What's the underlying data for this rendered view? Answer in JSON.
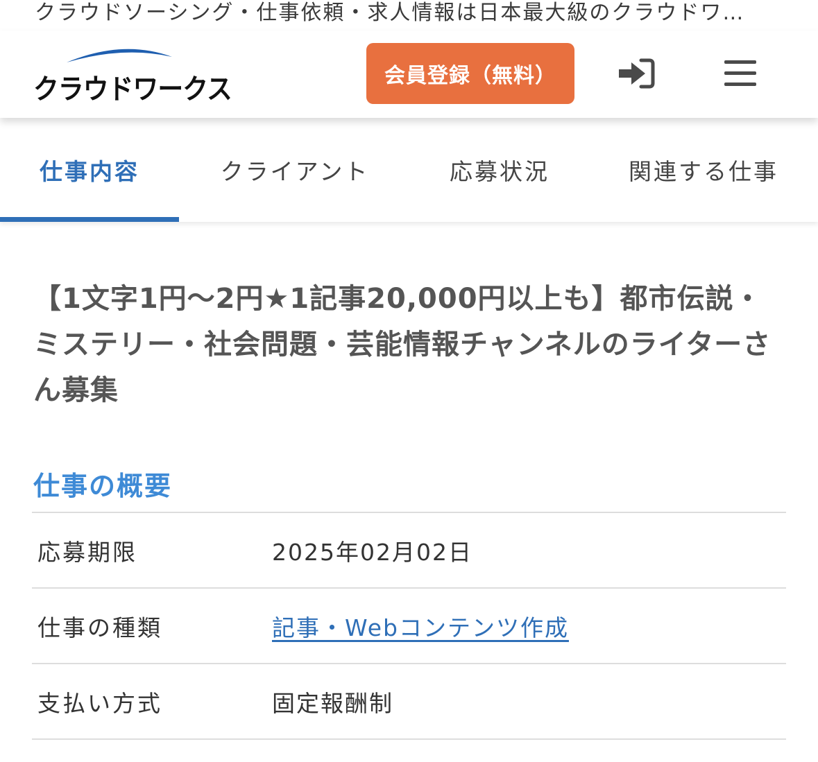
{
  "page_title": "クラウドソーシング・仕事依頼・求人情報は日本最大級のクラウドワ…",
  "header": {
    "logo_text": "クラウドワークス",
    "register_button_label": "会員登録（無料）",
    "login_icon": "login-arrow-icon",
    "menu_icon": "hamburger-menu-icon"
  },
  "tabs": [
    {
      "label": "仕事内容",
      "active": true
    },
    {
      "label": "クライアント",
      "active": false
    },
    {
      "label": "応募状況",
      "active": false
    },
    {
      "label": "関連する仕事",
      "active": false
    }
  ],
  "job": {
    "title": "【1文字1円〜2円★1記事20,000円以上も】都市伝説・ミステリー・社会問題・芸能情報チャンネルのライターさん募集"
  },
  "overview": {
    "heading": "仕事の概要",
    "rows": [
      {
        "label": "応募期限",
        "value": "2025年02月02日",
        "is_link": false
      },
      {
        "label": "仕事の種類",
        "value": "記事・Webコンテンツ作成",
        "is_link": true
      },
      {
        "label": "支払い方式",
        "value": "固定報酬制",
        "is_link": false
      }
    ]
  },
  "colors": {
    "accent_blue": "#2f6fb7",
    "heading_blue": "#3e8ad6",
    "register_orange": "#e8703f"
  }
}
